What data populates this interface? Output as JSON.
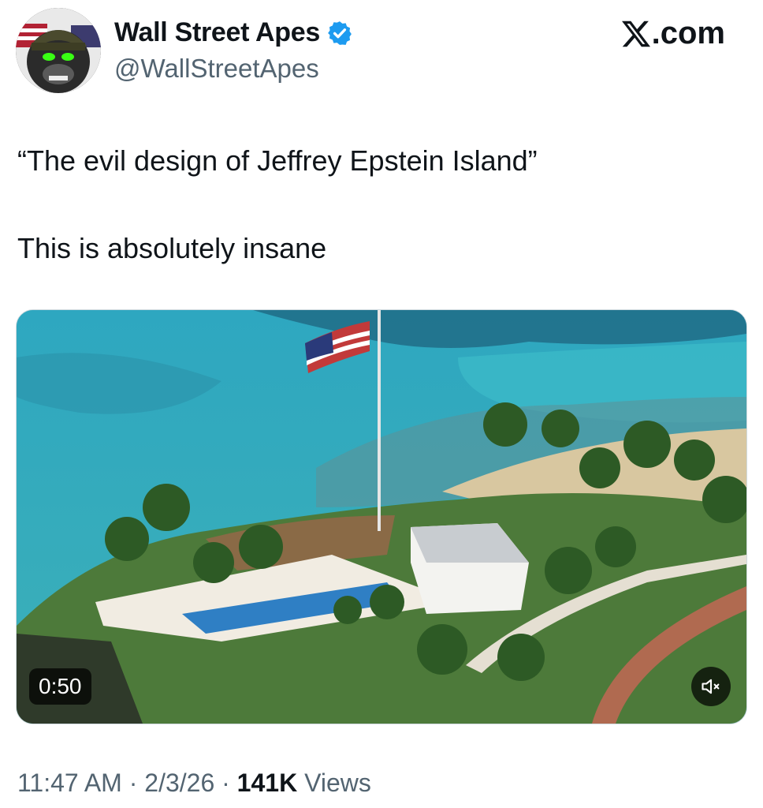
{
  "header": {
    "display_name": "Wall Street Apes",
    "handle": "@WallStreetApes",
    "site_label": ".com",
    "verified": true,
    "avatar_icon": "gorilla-soldier-avatar"
  },
  "tweet": {
    "line1": "“The evil design of Jeffrey Epstein Island”",
    "line2": "This is absolutely insane"
  },
  "media": {
    "duration": "0:50",
    "mute_icon": "speaker-muted-icon"
  },
  "meta": {
    "time": "11:47 AM",
    "date": "2/3/26",
    "views_count": "141K",
    "views_label": "Views",
    "separator": " · "
  },
  "colors": {
    "verified_blue": "#1d9bf0",
    "secondary_text": "#536471",
    "ocean": "#2fa6b8"
  }
}
